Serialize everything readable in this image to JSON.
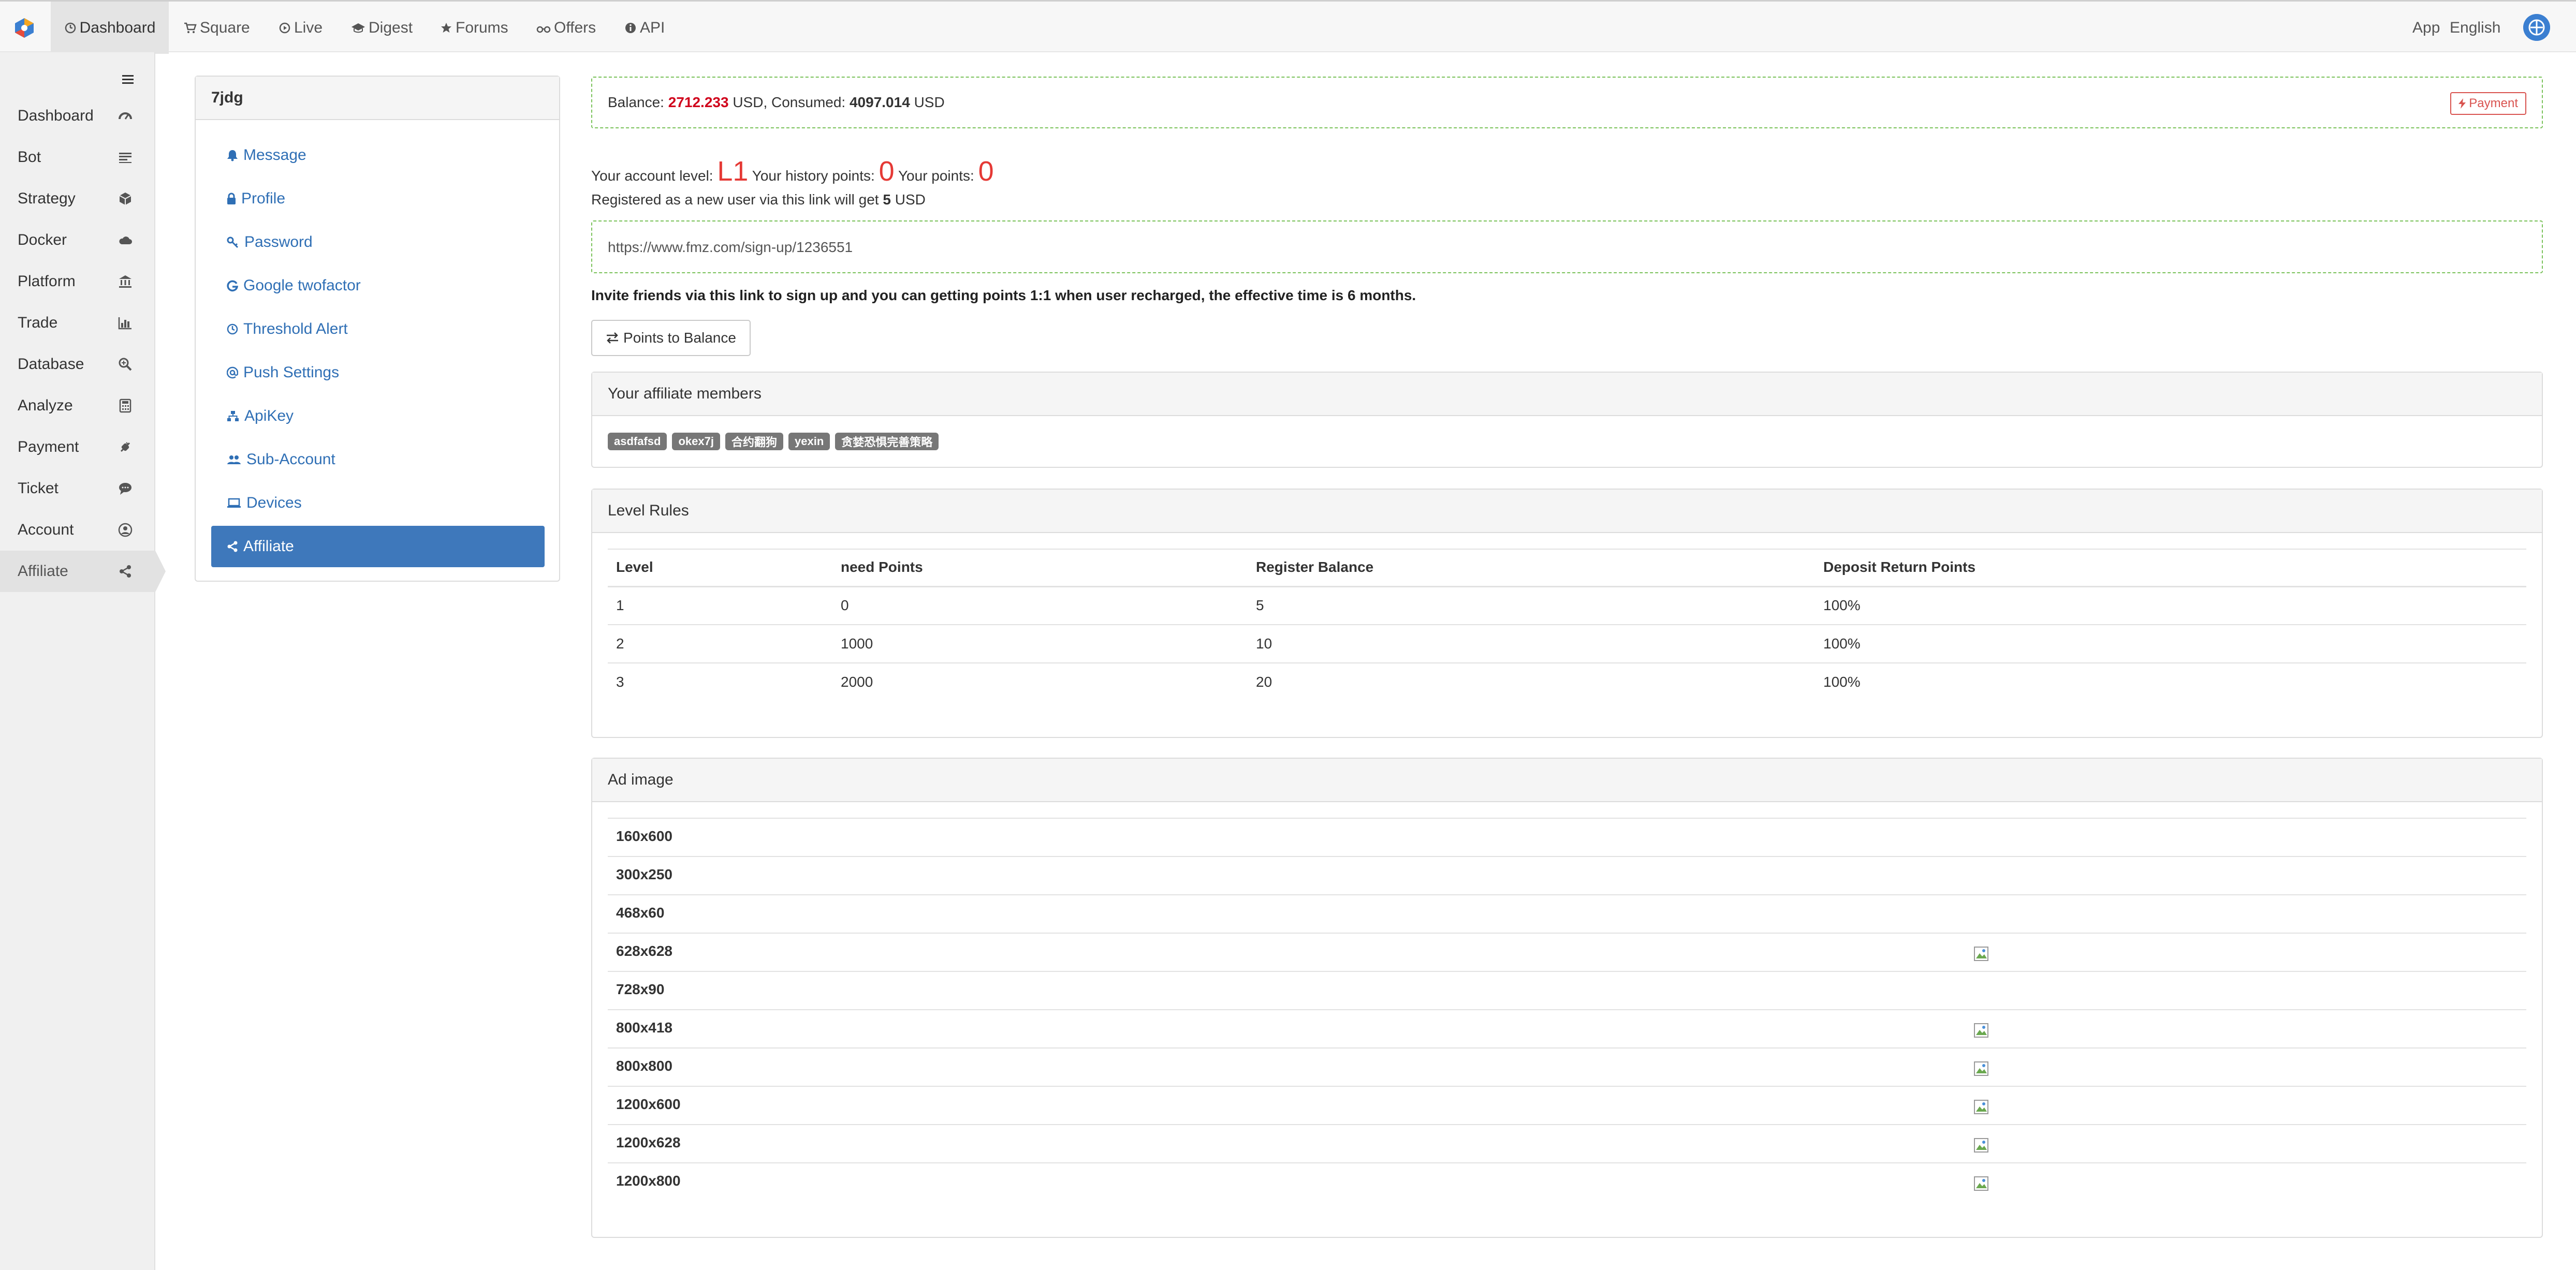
{
  "topnav": {
    "items": [
      {
        "label": "Dashboard",
        "icon": "dashboard-icon"
      },
      {
        "label": "Square",
        "icon": "cart-icon"
      },
      {
        "label": "Live",
        "icon": "play-icon"
      },
      {
        "label": "Digest",
        "icon": "graduation-icon"
      },
      {
        "label": "Forums",
        "icon": "star-icon"
      },
      {
        "label": "Offers",
        "icon": "binoculars-icon"
      },
      {
        "label": "API",
        "icon": "info-icon"
      }
    ],
    "right": {
      "app": "App",
      "language": "English"
    }
  },
  "sidebar": {
    "items": [
      {
        "label": "Dashboard",
        "icon": "dashboard-icon"
      },
      {
        "label": "Bot",
        "icon": "list-icon"
      },
      {
        "label": "Strategy",
        "icon": "cube-icon"
      },
      {
        "label": "Docker",
        "icon": "cloud-icon"
      },
      {
        "label": "Platform",
        "icon": "bank-icon"
      },
      {
        "label": "Trade",
        "icon": "bar-chart-icon"
      },
      {
        "label": "Database",
        "icon": "search-plus-icon"
      },
      {
        "label": "Analyze",
        "icon": "calculator-icon"
      },
      {
        "label": "Payment",
        "icon": "plug-icon"
      },
      {
        "label": "Ticket",
        "icon": "comment-icon"
      },
      {
        "label": "Account",
        "icon": "user-circle-icon"
      },
      {
        "label": "Affiliate",
        "icon": "share-icon"
      }
    ]
  },
  "settings": {
    "title": "7jdg",
    "items": [
      {
        "label": "Message",
        "icon": "bell-icon"
      },
      {
        "label": "Profile",
        "icon": "lock-icon"
      },
      {
        "label": "Password",
        "icon": "key-icon"
      },
      {
        "label": "Google twofactor",
        "icon": "google-icon"
      },
      {
        "label": "Threshold Alert",
        "icon": "clock-icon"
      },
      {
        "label": "Push Settings",
        "icon": "at-icon"
      },
      {
        "label": "ApiKey",
        "icon": "sitemap-icon"
      },
      {
        "label": "Sub-Account",
        "icon": "users-icon"
      },
      {
        "label": "Devices",
        "icon": "laptop-icon"
      },
      {
        "label": "Affiliate",
        "icon": "share-icon"
      }
    ]
  },
  "balance": {
    "balance_label": "Balance:",
    "balance_value": "2712.233",
    "balance_unit": "USD, Consumed:",
    "consumed_value": "4097.014",
    "consumed_unit": "USD",
    "payment_button": "Payment"
  },
  "account": {
    "level_label": "Your account level:",
    "level_value": "L1",
    "history_label": "Your history points:",
    "history_value": "0",
    "points_label": "Your points:",
    "points_value": "0",
    "register_text": "Registered as a new user via this link will get",
    "register_amount": "5",
    "register_unit": "USD"
  },
  "invite": {
    "link": "https://www.fmz.com/sign-up/1236551",
    "note": "Invite friends via this link to sign up and you can getting points 1:1 when user recharged, the effective time is 6 months.",
    "points_to_balance_button": "Points to Balance"
  },
  "affiliates": {
    "title": "Your affiliate members",
    "members": [
      "asdfafsd",
      "okex7j",
      "合约翻狗",
      "yexin",
      "贪婪恐惧完善策略"
    ]
  },
  "level_rules": {
    "title": "Level Rules",
    "headers": [
      "Level",
      "need Points",
      "Register Balance",
      "Deposit Return Points"
    ],
    "rows": [
      [
        "1",
        "0",
        "5",
        "100%"
      ],
      [
        "2",
        "1000",
        "10",
        "100%"
      ],
      [
        "3",
        "2000",
        "20",
        "100%"
      ]
    ]
  },
  "ad_images": {
    "title": "Ad image",
    "sizes": [
      "160x600",
      "300x250",
      "468x60",
      "628x628",
      "728x90",
      "800x418",
      "800x800",
      "1200x600",
      "1200x628",
      "1200x800"
    ],
    "has_image": [
      false,
      false,
      false,
      true,
      false,
      true,
      true,
      true,
      true,
      true
    ]
  }
}
